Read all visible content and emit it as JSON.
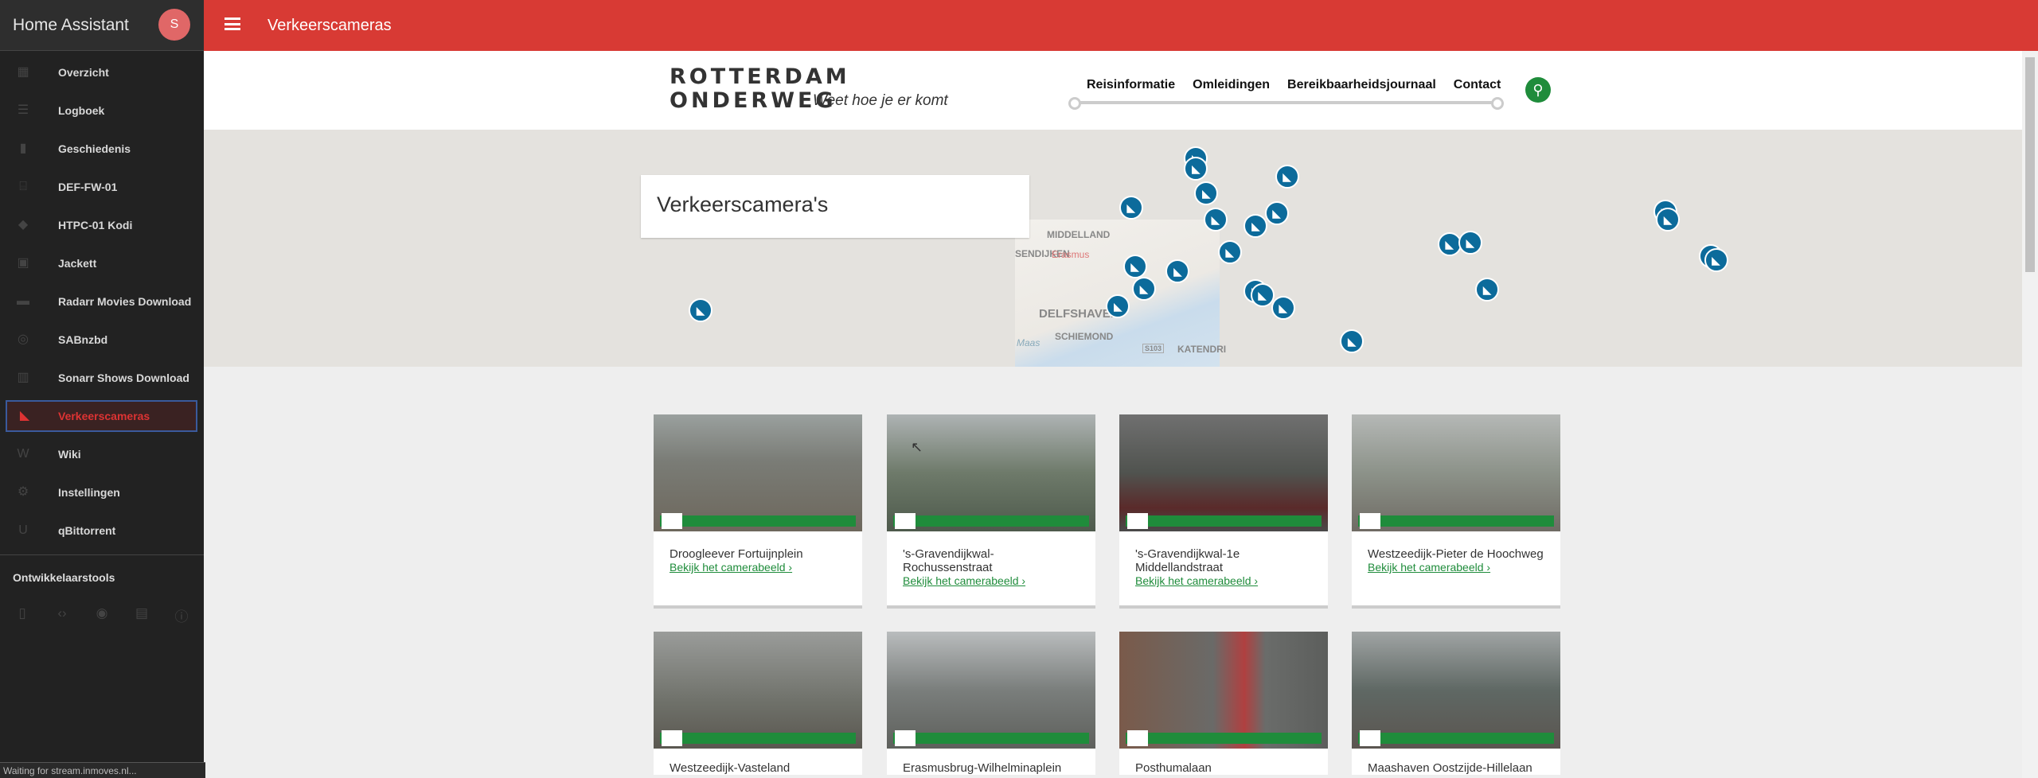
{
  "sidebar": {
    "title": "Home Assistant",
    "avatar": "S",
    "items": [
      {
        "label": "Overzicht",
        "icon": "grid-icon"
      },
      {
        "label": "Logboek",
        "icon": "list-icon"
      },
      {
        "label": "Geschiedenis",
        "icon": "chart-icon"
      },
      {
        "label": "DEF-FW-01",
        "icon": "router-icon"
      },
      {
        "label": "HTPC-01 Kodi",
        "icon": "kodi-icon"
      },
      {
        "label": "Jackett",
        "icon": "toolbox-icon"
      },
      {
        "label": "Radarr Movies Download",
        "icon": "clapperboard-icon"
      },
      {
        "label": "SABnzbd",
        "icon": "download-circle-icon"
      },
      {
        "label": "Sonarr Shows Download",
        "icon": "film-icon"
      },
      {
        "label": "Verkeerscameras",
        "icon": "cctv-icon",
        "active": true
      },
      {
        "label": "Wiki",
        "icon": "wikipedia-icon"
      },
      {
        "label": "Instellingen",
        "icon": "gear-icon"
      },
      {
        "label": "qBittorrent",
        "icon": "magnet-icon"
      }
    ],
    "dev_title": "Ontwikkelaarstools",
    "dev_icons": [
      "remote-icon",
      "code-icon",
      "broadcast-icon",
      "file-code-icon",
      "info-icon"
    ]
  },
  "status_bar": "Waiting for stream.inmoves.nl...",
  "topbar": {
    "title": "Verkeerscameras"
  },
  "site": {
    "logo": {
      "line1": "ROTTERDAM",
      "line2": "ONDERWEG",
      "tagline": "Weet hoe je er komt"
    },
    "nav": [
      "Reisinformatie",
      "Omleidingen",
      "Bereikbaarheidsjournaal",
      "Contact"
    ],
    "map": {
      "title": "Verkeerscamera's",
      "labels": [
        "MIDDELLAND",
        "SENDIJKEN",
        "Erasmus",
        "DELFSHAVEN",
        "SCHIEMOND",
        "KATENDRI",
        "S103",
        "Maas"
      ]
    },
    "link_label": "Bekijk het camerabeeld ›",
    "cameras": [
      "Droogleever Fortuijnplein",
      "'s-Gravendijkwal-Rochussenstraat",
      "'s-Gravendijkwal-1e Middellandstraat",
      "Westzeedijk-Pieter de Hoochweg",
      "Westzeedijk-Vasteland",
      "Erasmusbrug-Wilhelminaplein",
      "Posthumalaan",
      "Maashaven Oostzijde-Hillelaan"
    ]
  }
}
